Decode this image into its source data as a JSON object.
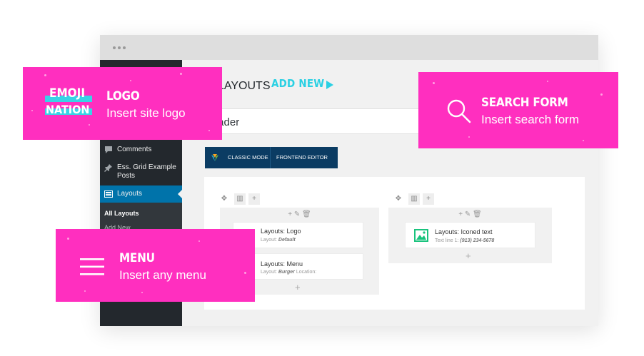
{
  "app": {
    "page_title": "LAYOUTS",
    "add_new_label": "ADD NEW",
    "title_input_value": "Header"
  },
  "sidebar": {
    "items": [
      {
        "label": "Comments",
        "icon": "comment-icon"
      },
      {
        "label": "Ess. Grid Example Posts",
        "icon": "pin-icon"
      },
      {
        "label": "Layouts",
        "icon": "layout-icon",
        "active": true
      }
    ],
    "submenu": [
      {
        "label": "All Layouts",
        "current": true
      },
      {
        "label": "Add New",
        "current": false
      }
    ]
  },
  "editor_bar": {
    "classic_mode_label": "CLASSIC MODE",
    "frontend_editor_label": "FRONTEND EDITOR"
  },
  "builder": {
    "columns": [
      {
        "elements": [
          {
            "title": "Layouts: Logo",
            "sub_label": "Layout:",
            "sub_value": "Default"
          },
          {
            "title": "Layouts: Menu",
            "sub_label": "Layout:",
            "sub_value": "Burger",
            "sub_extra": "Location:"
          }
        ]
      },
      {
        "elements": [
          {
            "title": "Layouts: Iconed text",
            "sub_label": "Text line 1:",
            "sub_value": "(913) 234-5678"
          }
        ]
      }
    ]
  },
  "cards": {
    "logo": {
      "brand_line1": "EMOJI",
      "brand_line2": "NATION",
      "title": "LOGO",
      "subtitle": "Insert site logo"
    },
    "search": {
      "title": "SEARCH FORM",
      "subtitle": "Insert search form",
      "icon": "search-icon"
    },
    "menu": {
      "title": "MENU",
      "subtitle": "Insert any menu",
      "icon": "hamburger-menu-icon"
    }
  },
  "colors": {
    "pink": "#ff2fbf",
    "accent_cyan": "#2ad0e3",
    "wp_blue": "#0073aa",
    "wp_dark": "#23282d",
    "vc_navy": "#0b3c63"
  }
}
